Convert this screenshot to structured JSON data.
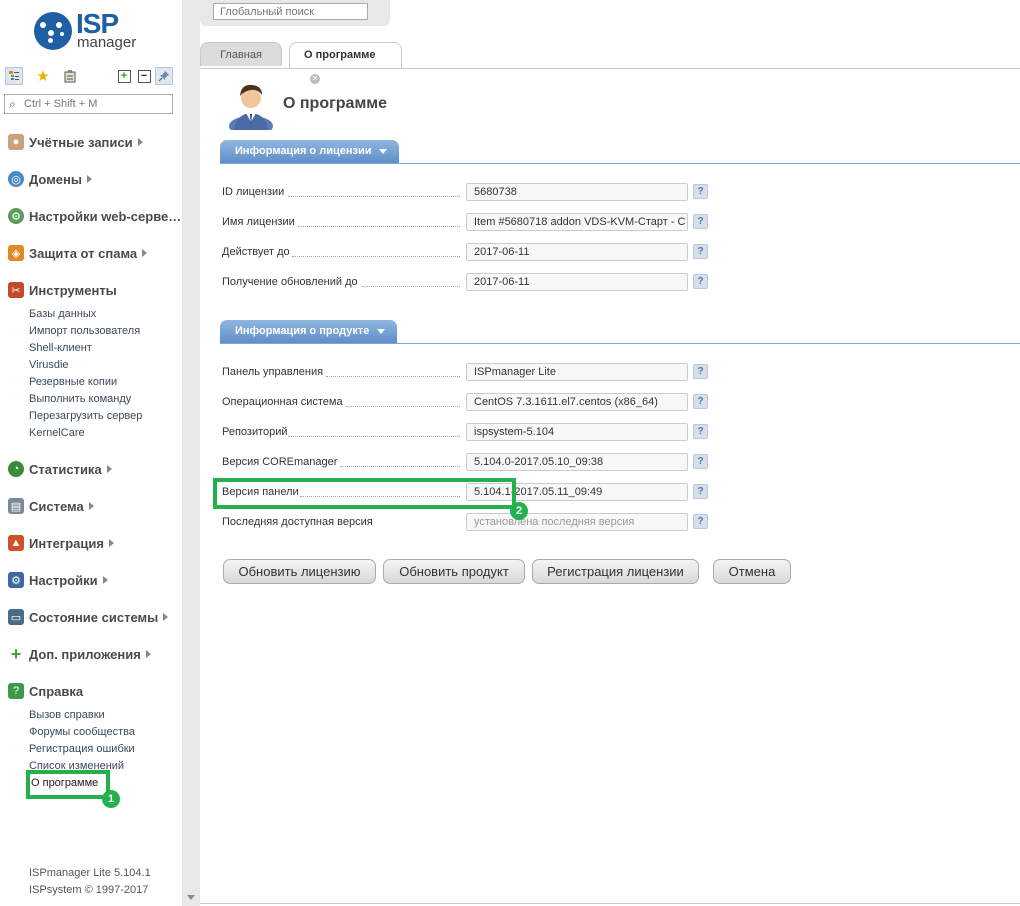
{
  "logo": {
    "line1": "ISP",
    "line2": "manager"
  },
  "sidebar": {
    "search_placeholder": "Ctrl + Shift + M",
    "groups": [
      {
        "label": "Учётные записи",
        "icon": "user-icon"
      },
      {
        "label": "Домены",
        "icon": "globe-icon"
      },
      {
        "label": "Настройки web-серве…",
        "icon": "web-settings-icon"
      },
      {
        "label": "Защита от спама",
        "icon": "shield-icon"
      },
      {
        "label": "Инструменты",
        "icon": "tools-icon"
      },
      {
        "label": "Статистика",
        "icon": "pie-chart-icon"
      },
      {
        "label": "Система",
        "icon": "system-icon"
      },
      {
        "label": "Интеграция",
        "icon": "integration-icon"
      },
      {
        "label": "Настройки",
        "icon": "settings-icon"
      },
      {
        "label": "Состояние системы",
        "icon": "monitor-icon"
      },
      {
        "label": "Доп. приложения",
        "icon": "plus-icon"
      },
      {
        "label": "Справка",
        "icon": "help-icon"
      }
    ],
    "tools_items": [
      "Базы данных",
      "Импорт пользователя",
      "Shell-клиент",
      "Virusdie",
      "Резервные копии",
      "Выполнить команду",
      "Перезагрузить сервер",
      "KernelCare"
    ],
    "help_items": [
      "Вызов справки",
      "Форумы сообщества",
      "Регистрация ошибки",
      "Список изменений",
      "О программе"
    ],
    "footer_version": "ISPmanager Lite 5.104.1",
    "footer_copyright": "ISPsystem © 1997-2017"
  },
  "topbar": {
    "global_search_placeholder": "Глобальный поиск"
  },
  "tabs": [
    {
      "label": "Главная"
    },
    {
      "label": "О программе"
    }
  ],
  "page_title": "О программе",
  "license_section": {
    "title": "Информация о лицензии",
    "fields": [
      {
        "label": "ID лицензии",
        "value": "5680738"
      },
      {
        "label": "Имя лицензии",
        "value": "Item #5680718 addon VDS-KVM-Старт - C"
      },
      {
        "label": "Действует до",
        "value": "2017-06-11"
      },
      {
        "label": "Получение обновлений до",
        "value": "2017-06-11"
      }
    ]
  },
  "product_section": {
    "title": "Информация о продукте",
    "fields": [
      {
        "label": "Панель управления",
        "value": "ISPmanager Lite"
      },
      {
        "label": "Операционная система",
        "value": "CentOS 7.3.1611.el7.centos (x86_64)"
      },
      {
        "label": "Репозиторий",
        "value": "ispsystem-5.104"
      },
      {
        "label": "Версия COREmanager",
        "value": "5.104.0-2017.05.10_09:38"
      },
      {
        "label": "Версия панели",
        "value": "5.104.1-2017.05.11_09:49"
      },
      {
        "label": "Последняя доступная версия",
        "placeholder": "установлена последняя версия"
      }
    ]
  },
  "buttons": {
    "update_license": "Обновить лицензию",
    "update_product": "Обновить продукт",
    "register_license": "Регистрация лицензии",
    "cancel": "Отмена"
  },
  "help_glyph": "?",
  "annotations": {
    "badge1": "1",
    "badge2": "2"
  },
  "colors": {
    "accent": "#1f5fa6",
    "section": "#6f9ed4",
    "highlight": "#22b14c"
  }
}
